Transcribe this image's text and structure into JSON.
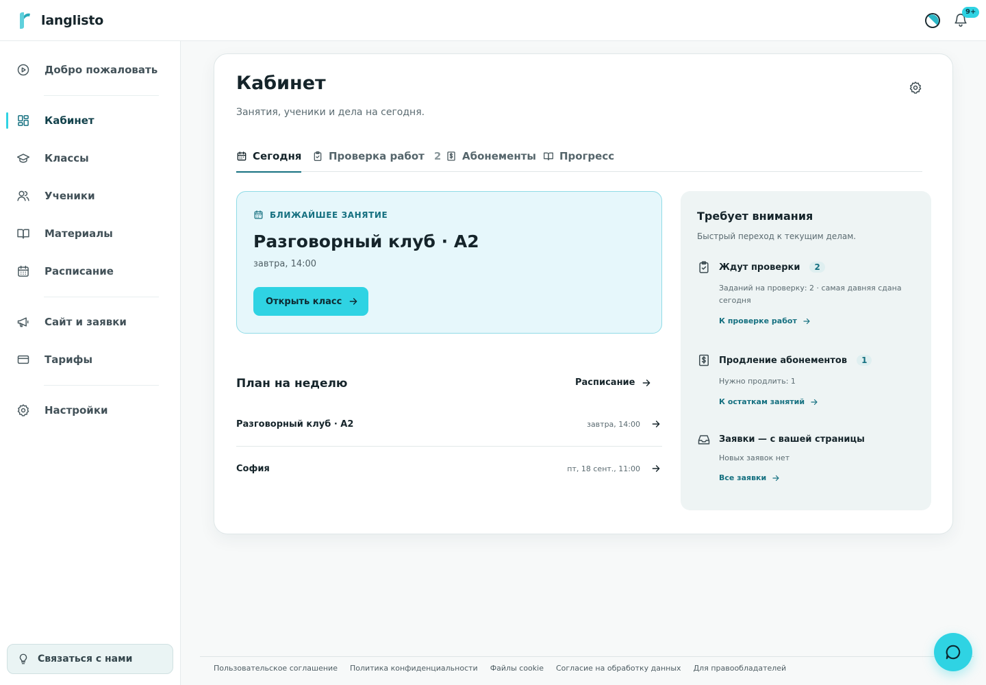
{
  "app": {
    "name": "langlisto"
  },
  "header": {
    "notifications_badge": "9+",
    "theme_icon": "theme-toggle-icon",
    "bell_icon": "bell-icon"
  },
  "colors": {
    "accent": "#2fd3e3",
    "brand_dark": "#157080",
    "text": "#15242a"
  },
  "sidebar": {
    "items": [
      {
        "label": "Добро пожаловать",
        "icon": "play-circle-icon"
      },
      {
        "label": "Кабинет",
        "icon": "dashboard-icon",
        "active": true
      },
      {
        "label": "Классы",
        "icon": "graduation-cap-icon"
      },
      {
        "label": "Ученики",
        "icon": "users-icon"
      },
      {
        "label": "Материалы",
        "icon": "book-icon"
      },
      {
        "label": "Расписание",
        "icon": "calendar-icon"
      },
      {
        "label": "Сайт и заявки",
        "icon": "megaphone-icon"
      },
      {
        "label": "Тарифы",
        "icon": "credit-card-icon"
      },
      {
        "label": "Настройки",
        "icon": "gear-icon"
      }
    ],
    "contact_label": "Связаться с нами"
  },
  "main": {
    "title": "Кабинет",
    "subtitle": "Занятия, ученики и дела на сегодня.",
    "tabs": [
      {
        "label": "Сегодня",
        "icon": "calendar-icon",
        "active": true
      },
      {
        "label": "Проверка работ",
        "icon": "clipboard-check-icon",
        "count": "2"
      },
      {
        "label": "Абонементы",
        "icon": "receipt-dollar-icon"
      },
      {
        "label": "Прогресс",
        "icon": "book-open-icon"
      }
    ],
    "next_lesson": {
      "kicker": "БЛИЖАЙШЕЕ ЗАНЯТИЕ",
      "title": "Разговорный клуб · A2",
      "time": "завтра, 14:00",
      "button_label": "Открыть класс"
    },
    "plan": {
      "title": "План на неделю",
      "link_label": "Расписание",
      "rows": [
        {
          "name": "Разговорный клуб · A2",
          "when": "завтра, 14:00"
        },
        {
          "name": "София",
          "when": "пт, 18 сент., 11:00"
        }
      ]
    },
    "attention": {
      "title": "Требует внимания",
      "subtitle": "Быстрый переход к текущим делам.",
      "items": [
        {
          "title": "Ждут проверки",
          "count": "2",
          "desc": "Заданий на проверку: 2 · самая давняя сдана сегодня",
          "link": "К проверке работ",
          "icon": "clipboard-check-icon"
        },
        {
          "title": "Продление абонементов",
          "count": "1",
          "desc": "Нужно продлить: 1",
          "link": "К остаткам занятий",
          "icon": "receipt-dollar-icon"
        },
        {
          "title": "Заявки — с вашей страницы",
          "count": "",
          "desc": "Новых заявок нет",
          "link": "Все заявки",
          "icon": "inbox-icon"
        }
      ]
    }
  },
  "footer": {
    "links": [
      "Пользовательское соглашение",
      "Политика конфиденциальности",
      "Файлы cookie",
      "Согласие на обработку данных",
      "Для правообладателей"
    ]
  }
}
